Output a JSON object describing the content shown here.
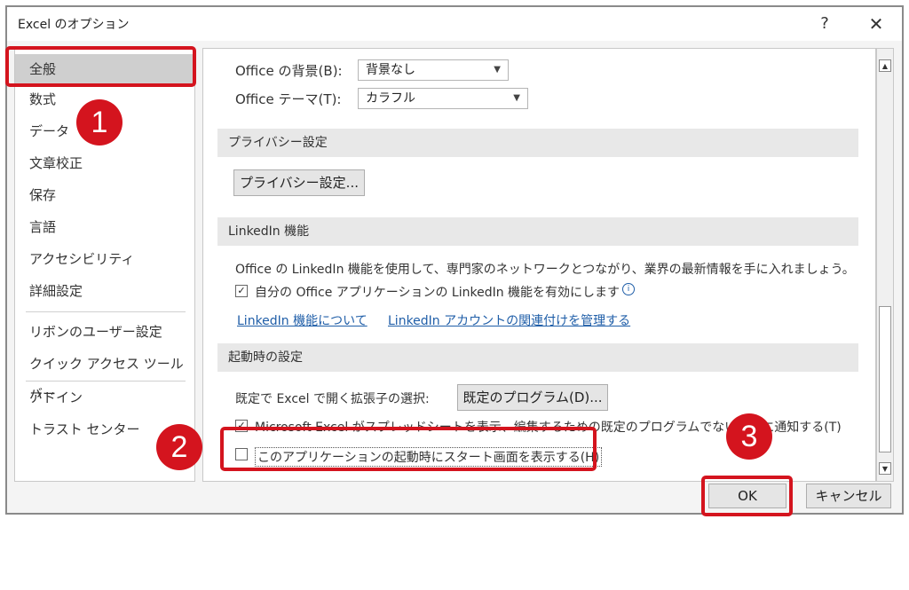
{
  "dialog": {
    "title": "Excel のオプション",
    "help_icon": "help-icon",
    "help_glyph": "?",
    "close_icon": "close-icon",
    "close_glyph": "✕"
  },
  "sidebar": {
    "items": [
      {
        "label": "全般",
        "selected": true
      },
      {
        "label": "数式"
      },
      {
        "label": "データ"
      },
      {
        "label": "文章校正"
      },
      {
        "label": "保存"
      },
      {
        "label": "言語"
      },
      {
        "label": "アクセシビリティ"
      },
      {
        "label": "詳細設定"
      },
      {
        "label": "リボンのユーザー設定"
      },
      {
        "label": "クイック アクセス ツール バー"
      },
      {
        "label": "アドイン"
      },
      {
        "label": "トラスト センター"
      }
    ]
  },
  "content": {
    "office_background_label": "Office の背景(B):",
    "office_background_value": "背景なし",
    "office_theme_label": "Office テーマ(T):",
    "office_theme_value": "カラフル",
    "privacy_section": "プライバシー設定",
    "privacy_button": "プライバシー設定...",
    "linkedin_section": "LinkedIn 機能",
    "linkedin_desc": "Office の LinkedIn 機能を使用して、専門家のネットワークとつながり、業界の最新情報を手に入れましょう。",
    "linkedin_checkbox": "自分の Office アプリケーションの LinkedIn 機能を有効にします",
    "linkedin_link1": "LinkedIn 機能について",
    "linkedin_link2": "LinkedIn アカウントの関連付けを管理する",
    "startup_section": "起動時の設定",
    "default_ext_label": "既定で Excel で開く拡張子の選択:",
    "default_programs_button": "既定のプログラム(D)...",
    "notify_checkbox": "Microsoft Excel がスプレッドシートを表示、編集するための既定のプログラムでない場合に通知する(T)",
    "start_screen_checkbox": "このアプリケーションの起動時にスタート画面を表示する(H)",
    "dropdown_caret": "▼",
    "check_mark": "✓"
  },
  "scrollbar": {
    "up": "▲",
    "down": "▼"
  },
  "footer": {
    "ok": "OK",
    "cancel": "キャンセル"
  },
  "annotations": {
    "badge1": "1",
    "badge2": "2",
    "badge3": "3",
    "color": "#d4141e"
  }
}
